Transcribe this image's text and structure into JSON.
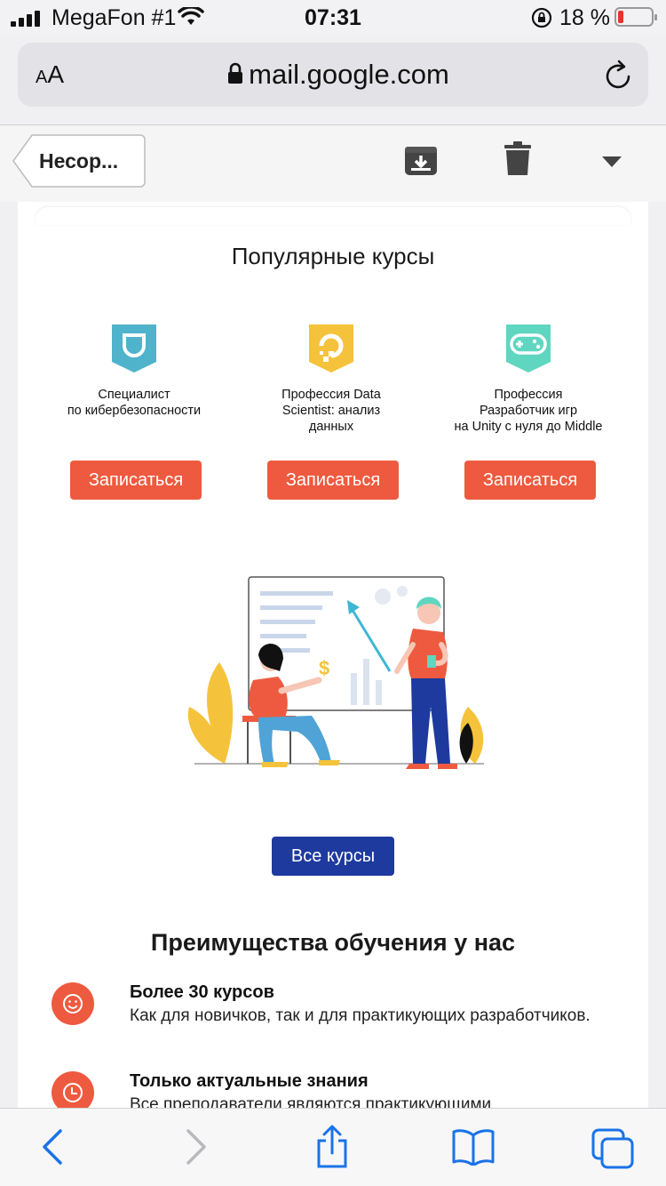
{
  "status_bar": {
    "carrier": "MegaFon #1",
    "time": "07:31",
    "battery_percent": "18 %",
    "battery_level": 0.18
  },
  "browser": {
    "text_size_label_small": "A",
    "text_size_label_large": "A",
    "url": "mail.google.com"
  },
  "toolbar": {
    "back_label": "Несор..."
  },
  "email": {
    "popular_title": "Популярные курсы",
    "courses": [
      {
        "name_lines": [
          "Специалист",
          "по кибербезопасности"
        ],
        "button": "Записаться",
        "color": "#4fb3cc",
        "icon": "shield-icon"
      },
      {
        "name_lines": [
          "Профессия Data",
          "Scientist: анализ",
          "данных"
        ],
        "button": "Записаться",
        "color": "#f5c33b",
        "icon": "data-icon"
      },
      {
        "name_lines": [
          "Профессия",
          "Разработчик игр",
          "на Unity с нуля до Middle"
        ],
        "button": "Записаться",
        "color": "#5fd6c0",
        "icon": "gamepad-icon"
      }
    ],
    "illustration_currency": "$",
    "all_courses_button": "Все курсы",
    "advantages_title": "Преимущества обучения у нас",
    "advantages": [
      {
        "title": "Более 30 курсов",
        "text": "Как для новичков, так и для практикующих разработчиков.",
        "icon": "smile-icon"
      },
      {
        "title": "Только актуальные знания",
        "text": "Все преподаватели являются практикующими",
        "icon": "clock-icon"
      }
    ],
    "accent_color": "#ee5a3f",
    "primary_color": "#1e3a9e"
  }
}
